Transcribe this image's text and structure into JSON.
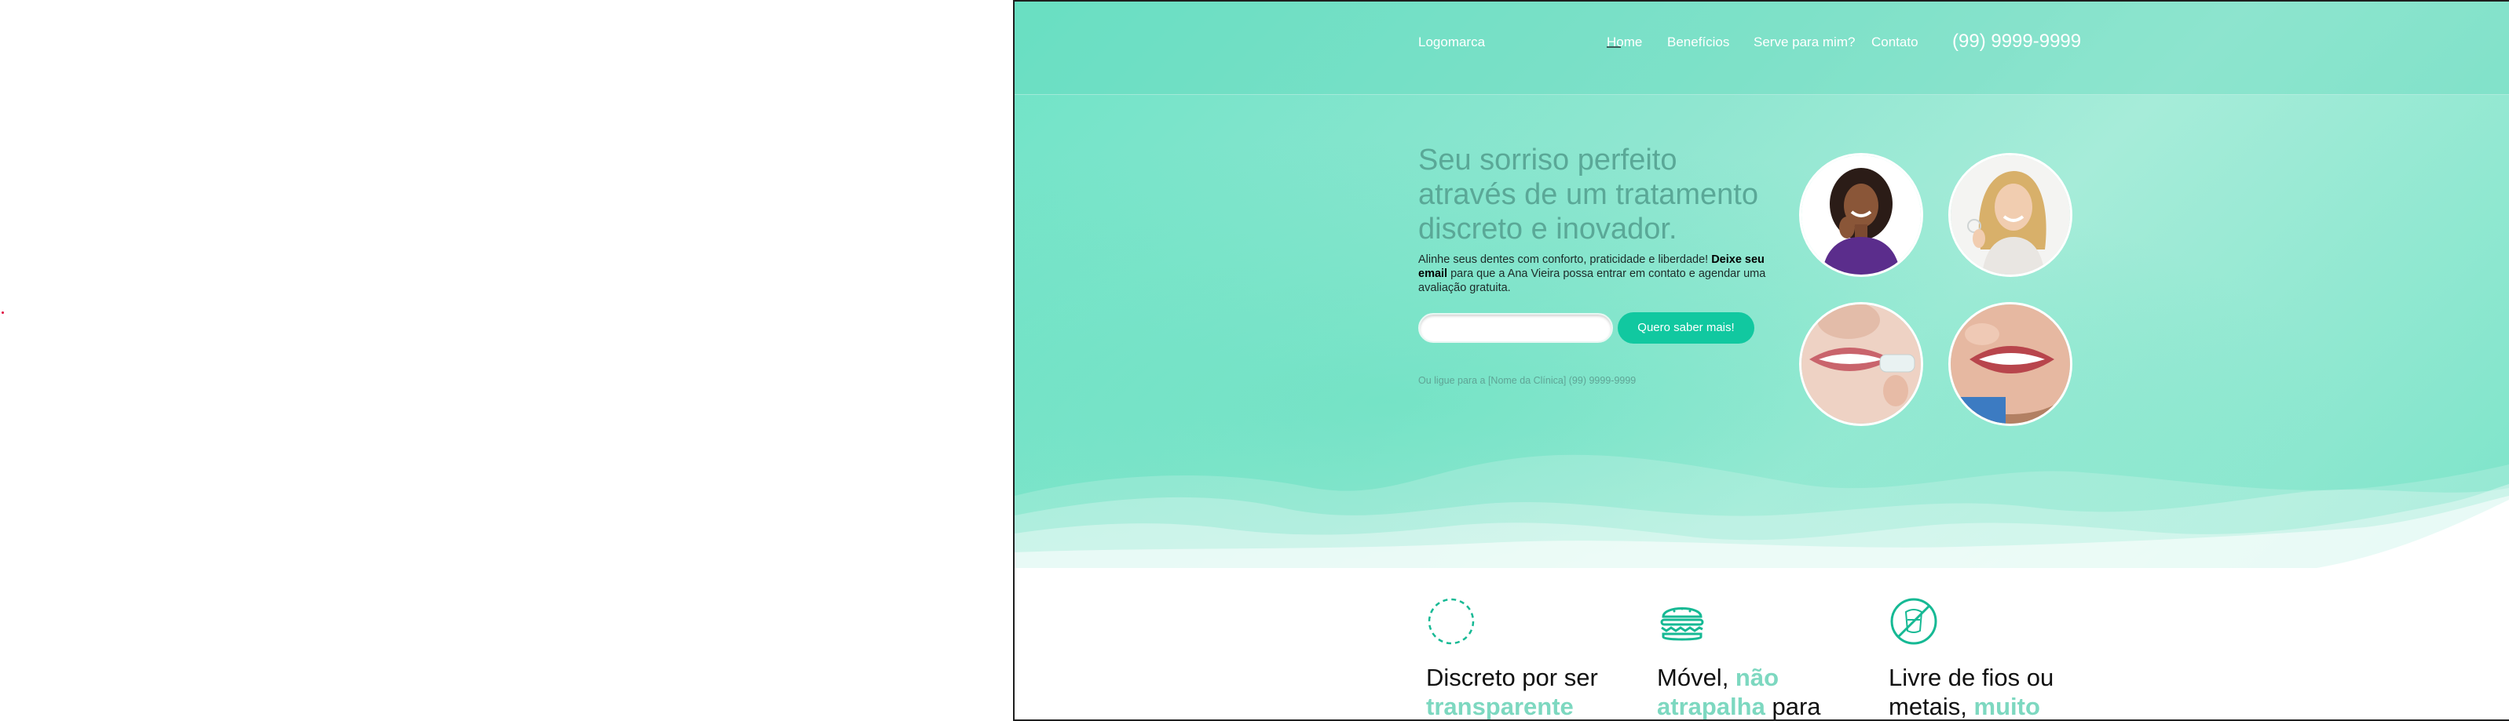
{
  "nav": {
    "logo": "Logomarca",
    "links": [
      "Home",
      "Benefícios",
      "Serve para mim?",
      "Contato"
    ],
    "phone": "(99) 9999-9999"
  },
  "hero": {
    "headline": "Seu sorriso perfeito através de um tratamento discreto e inovador.",
    "intro_1": "Alinhe seus dentes com conforto, praticidade e liberdade! ",
    "intro_bold": "Deixe seu email",
    "intro_2": " para que a Ana Vieira possa entrar em contato e agendar uma avaliação gratuita.",
    "email_placeholder": "",
    "cta": "Quero saber mais!",
    "call_line": "Ou ligue para a [Nome da Clínica] (99) 9999-9999"
  },
  "features": [
    {
      "icon": "dashed-circle-icon",
      "title_1": "Discreto por ser ",
      "title_accent": "transparente",
      "title_2": ""
    },
    {
      "icon": "burger-icon",
      "title_1": "Móvel, ",
      "title_accent": "não atrapalha",
      "title_2": " para"
    },
    {
      "icon": "no-wires-icon",
      "title_1": "Livre de fios ou metais, ",
      "title_accent": "muito mais",
      "title_2": ""
    }
  ],
  "colors": {
    "accent": "#11c8a0",
    "hero_bg": "#8fe6d0",
    "headline": "#5aa897",
    "feature_accent": "#7dd8c0"
  }
}
